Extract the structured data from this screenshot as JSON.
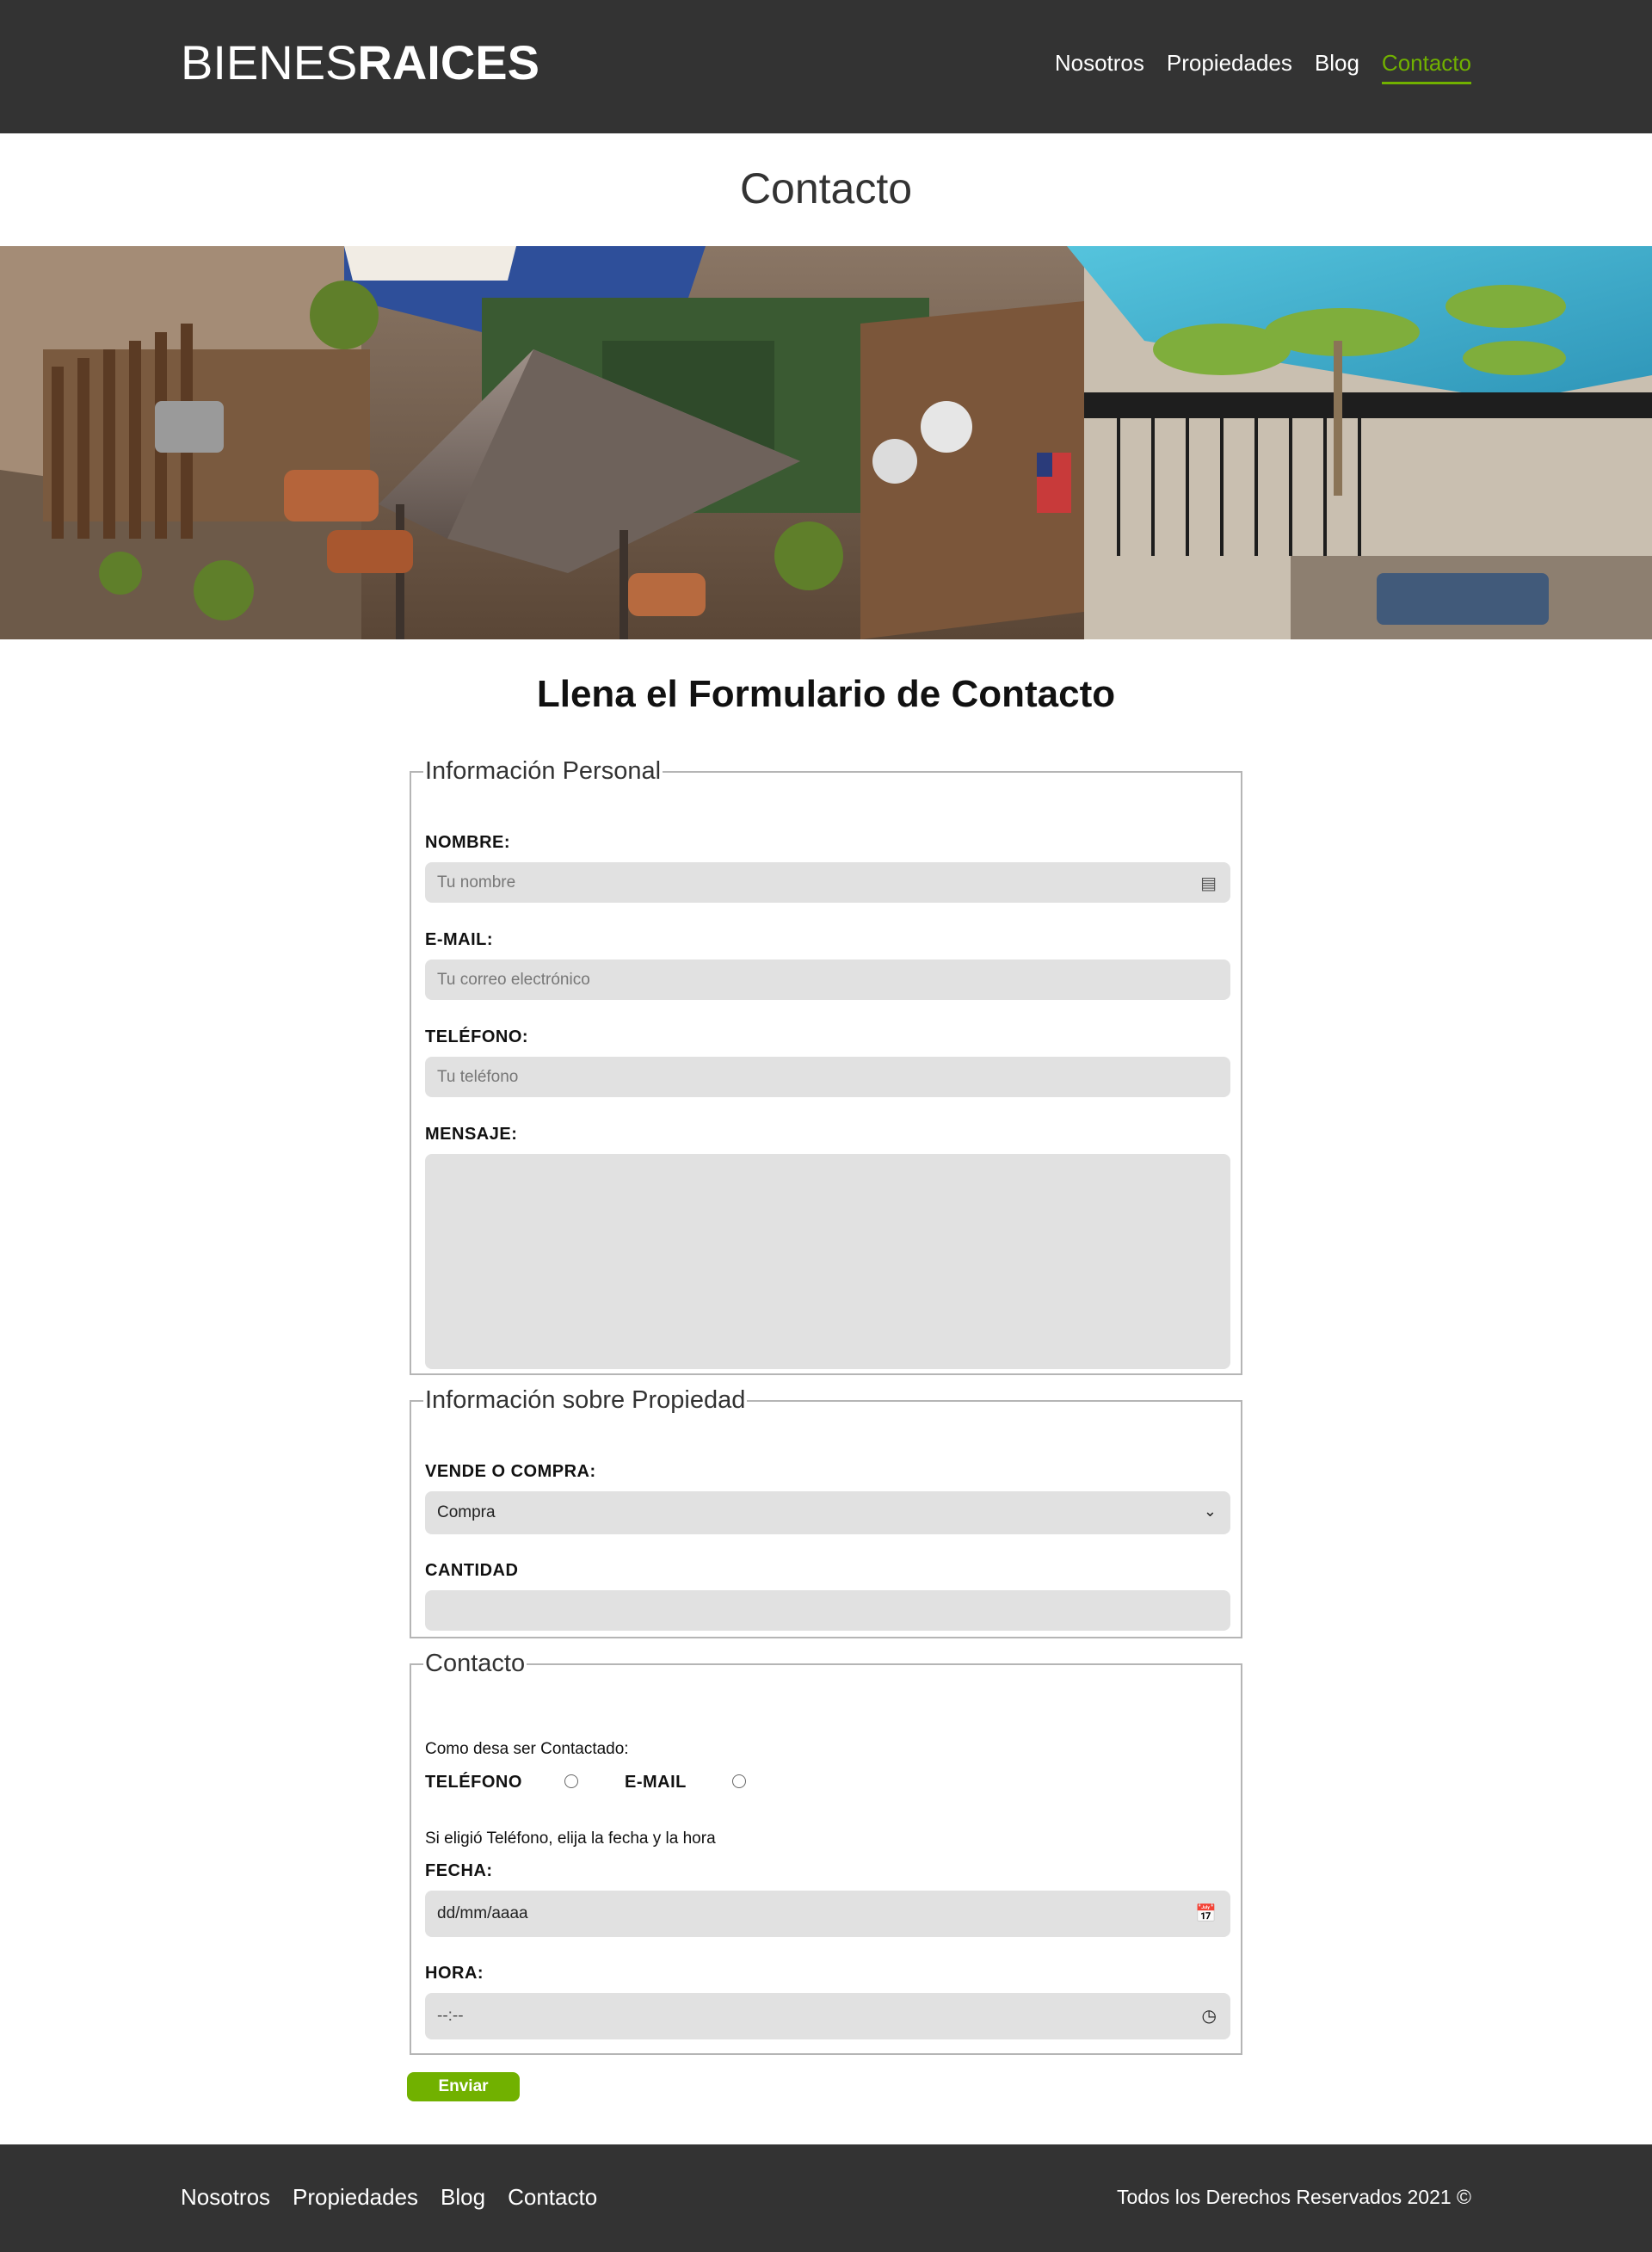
{
  "header": {
    "logo_light": "BIENES",
    "logo_bold": "RAICES",
    "nav": [
      "Nosotros",
      "Propiedades",
      "Blog",
      "Contacto"
    ],
    "active_nav": "Contacto",
    "accent_color": "#71b100",
    "bg_color": "#333333"
  },
  "page": {
    "title": "Contacto",
    "form_heading": "Llena el Formulario de Contacto"
  },
  "personal": {
    "legend": "Información Personal",
    "nombre_label": "NOMBRE:",
    "nombre_placeholder": "Tu nombre",
    "email_label": "E-MAIL:",
    "email_placeholder": "Tu correo electrónico",
    "telefono_label": "TELÉFONO:",
    "telefono_placeholder": "Tu teléfono",
    "mensaje_label": "MENSAJE:"
  },
  "propiedad": {
    "legend": "Información sobre Propiedad",
    "tipo_label": "VENDE O COMPRA:",
    "tipo_selected": "Compra",
    "cantidad_label": "CANTIDAD"
  },
  "contacto": {
    "legend": "Contacto",
    "prompt": "Como desa ser Contactado:",
    "opt_telefono": "TELÉFONO",
    "opt_email": "E-MAIL",
    "hint": "Si eligió Teléfono, elija la fecha y la hora",
    "fecha_label": "FECHA:",
    "fecha_placeholder": "dd/mm/aaaa",
    "hora_label": "HORA:",
    "hora_placeholder": "--:--"
  },
  "submit_label": "Enviar",
  "footer": {
    "nav": [
      "Nosotros",
      "Propiedades",
      "Blog",
      "Contacto"
    ],
    "copyright": "Todos los Derechos Reservados 2021 ©"
  }
}
